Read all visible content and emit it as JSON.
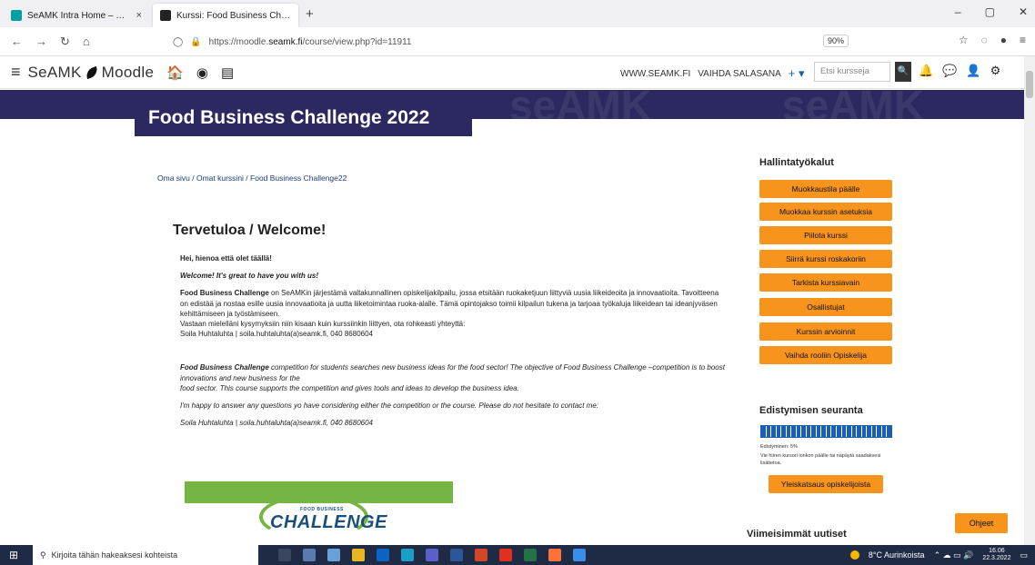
{
  "browser": {
    "tabs": [
      {
        "title": "SeAMK Intra Home – Kotisivu",
        "close": "×",
        "active": false,
        "color": "#00a0a0"
      },
      {
        "title": "Kurssi: Food Business Challenge ×",
        "close": "×",
        "active": true,
        "color": "#222222"
      }
    ],
    "new_tab": "+",
    "url_prefix": "https://moodle.",
    "url_domain": "seamk.fi",
    "url_suffix": "/course/view.php?id=11911",
    "zoom": "90%",
    "window_controls": [
      "–",
      "▢",
      "✕"
    ]
  },
  "moodle_header": {
    "brand_left": "SeAMK",
    "brand_right": "Moodle",
    "links": [
      "WWW.SEAMK.FI",
      "VAIHDA SALASANA"
    ],
    "plus": "+ ▾",
    "search_placeholder": "Etsi kursseja",
    "search_icon": "🔍"
  },
  "banner": {
    "title": "Food Business Challenge 2022",
    "watermark": "seAMK"
  },
  "breadcrumb": "Oma sivu / Omat kurssini / Food Business Challenge22",
  "main": {
    "title": "Tervetuloa / Welcome!",
    "greeting_fi": "Hei, hienoa että olet täällä!",
    "greeting_en": "Welcome! It's great to have you with us!",
    "fi_lead": "Food Business Challenge",
    "fi_body": " on SeAMKin järjestämä valtakunnallinen opiskelijakilpailu, jossa etsitään ruokaketjuun liittyviä uusia liikeideoita ja innovaatioita. Tavoitteena on edistää ja nostaa esille uusia innovaatioita ja uutta liiketoimintaa ruoka-alalle. Tämä opintojakso toimii kilpailun tukena ja tarjoaa työkaluja liikeidean tai ideanjyväsen kehittämiseen ja työstämiseen.",
    "fi_contact_intro": "Vastaan mielelläni kysymyksiin niin kisaan kuin kurssiinkin liittyen, ota rohkeasti yhteyttä:",
    "fi_contact": "Soila Huhtaluhta | soila.huhtaluhta(a)seamk.fi, 040 8680604",
    "en_lead": "Food Business Challenge",
    "en_body": " competition for students searches new business ideas for the food sector! The objective of Food Business Challenge –competition is to boost innovations and new business for the",
    "en_body2": "food sector. This course supports the competition and gives tools and ideas to develop the business idea.",
    "en_contact_intro": "I'm happy to answer any questions yo have considering either the competition or the course. Please do not hesitate to contact me:",
    "en_contact": "Soila Huhtaluhta | soila.huhtaluhta(a)seamk.fi, 040 8680604",
    "logo_small": "FOOD BUSINESS",
    "logo_big": "CHALLENGE"
  },
  "sidebar": {
    "admin_title": "Hallintatyökalut",
    "admin_buttons": [
      "Muokkaustila päälle",
      "Muokkaa kurssin asetuksia",
      "Piilota kurssi",
      "Siirrä kurssi roskakoriin",
      "Tarkista kurssiavain",
      "Osallistujat",
      "Kurssin arvioinnit",
      "Vaihda rooliin Opiskelija"
    ],
    "progress_title": "Edistymisen seuranta",
    "progress_percent": 5,
    "progress_label": "Edistyminen: 5%",
    "progress_hint": "Vie hiiren kursori ionkon päälle tai näpäytä saadaksesi lisätietoa.",
    "overview_button": "Yleiskatsaus opiskelijoista",
    "news_title": "Viimeisimmät uutiset"
  },
  "help_button": "Ohjeet",
  "taskbar": {
    "search_placeholder": "Kirjoita tähän hakeaksesi kohteista",
    "weather": "8°C Aurinkoista",
    "time": "16.06",
    "date": "22.3.2022"
  }
}
